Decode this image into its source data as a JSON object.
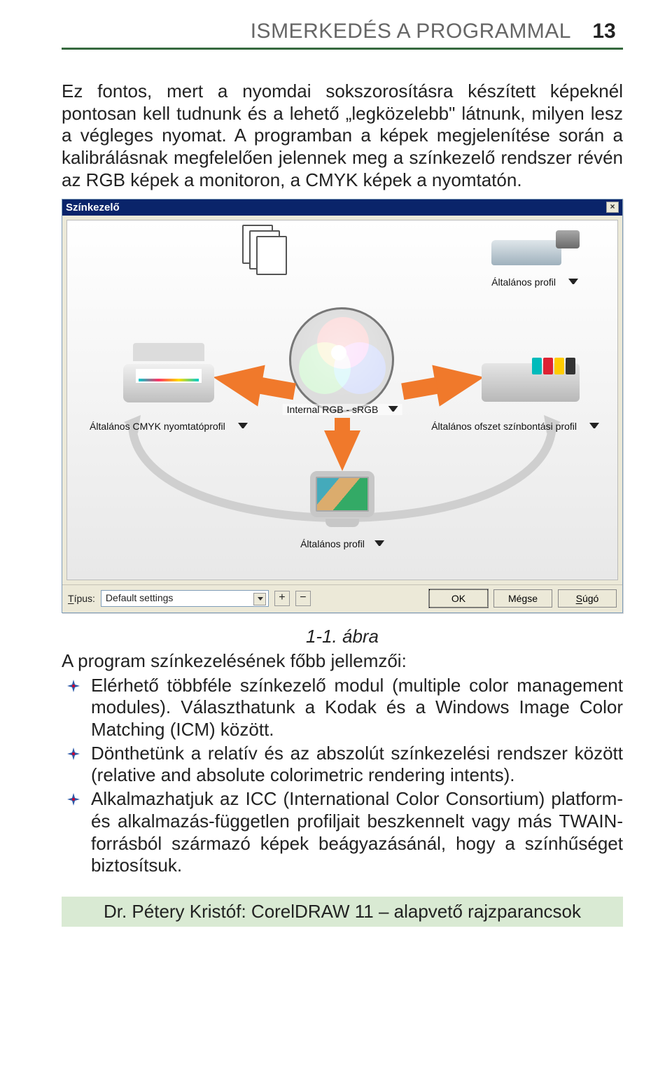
{
  "header": {
    "title": "ISMERKEDÉS A PROGRAMMAL",
    "page_number": "13"
  },
  "intro": {
    "p1": "Ez fontos, mert a nyomdai sokszorosításra készített képeknél pontosan kell tudnunk és a lehető „legközelebb\" látnunk, milyen lesz a végleges nyomat. A programban a képek megjelenítése során a kalibrálásnak megfelelően jelennek meg a színkezelő rendszer révén az RGB képek a monitoron, a CMYK képek a nyomtatón."
  },
  "dialog": {
    "title": "Színkezelő",
    "scanner_label": "Általános profil",
    "center_label": "Internal RGB - sRGB",
    "printer_label": "Általános CMYK nyomtatóprofil",
    "press_label": "Általános ofszet színbontási profil",
    "monitor_label": "Általános profil",
    "footer": {
      "type_label": "Típus:",
      "type_value": "Default settings",
      "ok": "OK",
      "cancel": "Mégse",
      "help": "Súgó"
    }
  },
  "caption": "1-1. ábra",
  "lead": "A program színkezelésének főbb jellemzői:",
  "bullets": [
    "Elérhető többféle színkezelő modul (multiple color management modules). Választhatunk a Kodak és a Windows Image Color Matching (ICM) között.",
    "Dönthetünk a relatív és az abszolút színkezelési rendszer között (relative and absolute colorimetric rendering intents).",
    "Alkalmazhatjuk az ICC (International Color Consortium) platform- és alkalmazás-független profiljait beszkennelt vagy más TWAIN-forrásból származó képek beágyazásánál, hogy a színhűséget biztosítsuk."
  ],
  "footer_text": "Dr. Pétery Kristóf: CorelDRAW 11 – alapvető rajzparancsok"
}
